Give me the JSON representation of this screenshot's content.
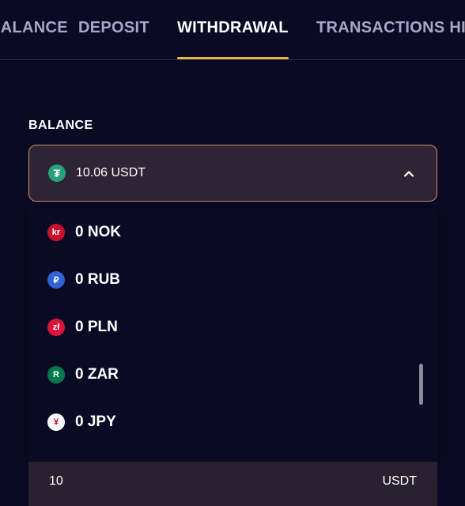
{
  "tabs": [
    {
      "label": "BALANCE",
      "active": false
    },
    {
      "label": "DEPOSIT",
      "active": false
    },
    {
      "label": "WITHDRAWAL",
      "active": true
    },
    {
      "label": "TRANSACTIONS HISTORY",
      "active": false
    }
  ],
  "balance": {
    "label": "BALANCE",
    "selected": {
      "value": "10.06 USDT",
      "icon": "tether-icon",
      "symbol": "₮",
      "color": "#26a17b"
    },
    "options": [
      {
        "label": "0 NOK",
        "icon": "nok-icon",
        "symbol": "kr",
        "color": "#c8102e"
      },
      {
        "label": "0 RUB",
        "icon": "rub-icon",
        "symbol": "₽",
        "color": "#2d62d8"
      },
      {
        "label": "0 PLN",
        "icon": "pln-icon",
        "symbol": "zł",
        "color": "#dc143c"
      },
      {
        "label": "0 ZAR",
        "icon": "zar-icon",
        "symbol": "R",
        "color": "#007a4d"
      },
      {
        "label": "0 JPY",
        "icon": "jpy-icon",
        "symbol": "¥",
        "color": "#ffffff",
        "symbolColor": "#bc002d"
      }
    ]
  },
  "amount": {
    "value": "10",
    "unit": "USDT"
  },
  "colors": {
    "accent": "#e8b93a",
    "background": "#0b0a24",
    "selectBorder": "#c79468"
  }
}
